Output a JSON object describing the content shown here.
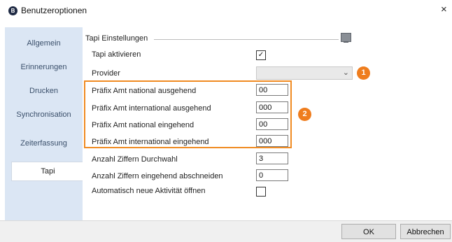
{
  "window": {
    "title": "Benutzeroptionen",
    "app_icon": "B",
    "close_label": "×"
  },
  "sidebar": {
    "items": [
      {
        "label": "Allgemein",
        "active": false
      },
      {
        "label": "Erinnerungen",
        "active": false
      },
      {
        "label": "Drucken",
        "active": false
      },
      {
        "label": "Synchronisation",
        "active": false
      },
      {
        "label": "Zeiterfassung",
        "active": false
      },
      {
        "label": "Tapi",
        "active": true
      }
    ]
  },
  "tapi": {
    "group_title": "Tapi Einstellungen",
    "activate": {
      "label": "Tapi aktivieren",
      "checked": true
    },
    "provider": {
      "label": "Provider",
      "value": ""
    },
    "prefix_national_out": {
      "label": "Präfix Amt national ausgehend",
      "value": "00"
    },
    "prefix_international_out": {
      "label": "Präfix Amt international ausgehend",
      "value": "000"
    },
    "prefix_national_in": {
      "label": "Präfix Amt national eingehend",
      "value": "00"
    },
    "prefix_international_in": {
      "label": "Präfix Amt international eingehend",
      "value": "000"
    },
    "digits_extension": {
      "label": "Anzahl Ziffern Durchwahl",
      "value": "3"
    },
    "digits_incoming_trim": {
      "label": "Anzahl Ziffern eingehend abschneiden",
      "value": "0"
    },
    "auto_open_activity": {
      "label": "Automatisch neue Aktivität öffnen",
      "checked": false
    }
  },
  "annotations": {
    "badge_1": "1",
    "badge_2": "2",
    "accent_color": "#ef7d1e"
  },
  "buttons": {
    "ok": "OK",
    "cancel": "Abbrechen"
  }
}
